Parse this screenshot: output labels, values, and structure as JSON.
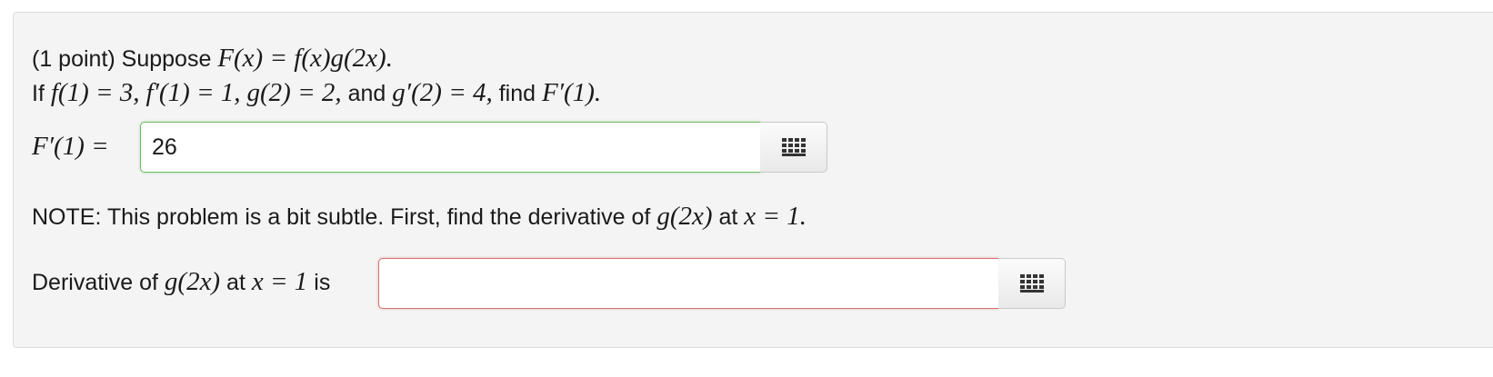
{
  "problem": {
    "intro_text": "(1 point) Suppose",
    "intro_math": "F(x) = f(x)g(2x).",
    "given_prefix": "If",
    "given_1": "f(1) = 3,",
    "given_2": "f′(1) = 1,",
    "given_3": "g(2) = 2,",
    "given_and": "and",
    "given_4": "g′(2) = 4,",
    "given_find": "find",
    "given_target": "F′(1)."
  },
  "answer_1": {
    "label_math": "F′(1) =",
    "value": "26",
    "status": "correct",
    "status_color": "#6fba63",
    "toolbar_icon": "keypad-grid-icon"
  },
  "note": {
    "text": "NOTE: This problem is a bit subtle. First, find the derivative of",
    "math_1": "g(2x)",
    "text_2": "at",
    "math_2": "x = 1."
  },
  "answer_2": {
    "label_text": "Derivative of",
    "label_math_1": "g(2x)",
    "label_text_2": "at",
    "label_math_2": "x = 1",
    "label_text_3": "is",
    "value": "",
    "status": "incorrect",
    "status_color": "#d87070",
    "toolbar_icon": "keypad-grid-icon"
  }
}
